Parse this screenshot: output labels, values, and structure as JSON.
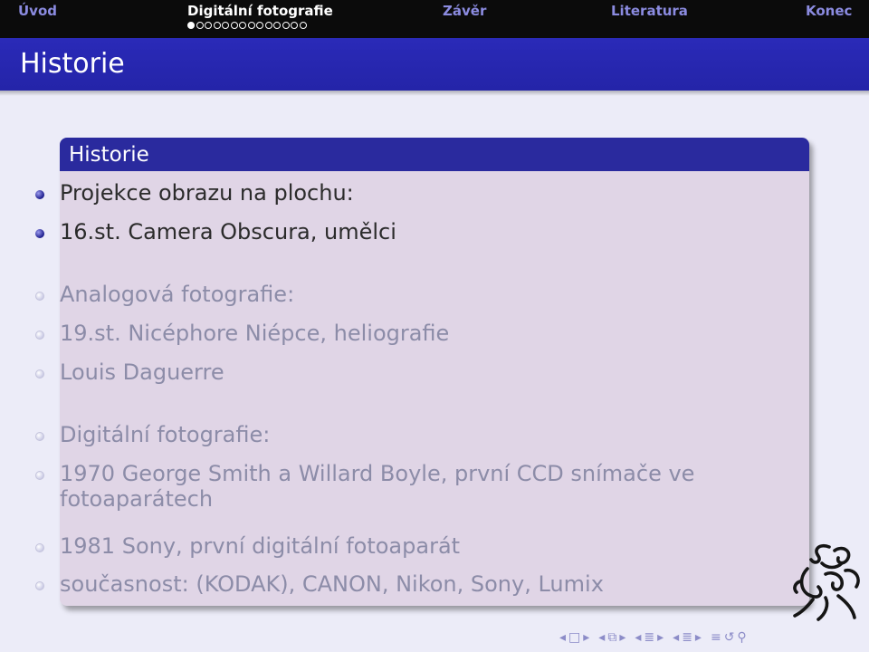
{
  "nav": {
    "items": [
      "Úvod",
      "Digitální fotografie",
      "Závěr",
      "Literatura",
      "Konec"
    ],
    "active_index": 1,
    "progress": {
      "current": 1,
      "total": 14
    }
  },
  "frame": {
    "title": "Historie"
  },
  "block": {
    "title": "Historie",
    "items": [
      {
        "text": "Projekce obrazu na plochu:",
        "visible": true
      },
      {
        "text": "16.st. Camera Obscura, umělci",
        "visible": true
      },
      {
        "text": "Analogová fotografie:",
        "visible": false
      },
      {
        "text": "19.st. Nicéphore Niépce, heliografie",
        "visible": false
      },
      {
        "text": "Louis Daguerre",
        "visible": false
      },
      {
        "text": "Digitální fotografie:",
        "visible": false
      },
      {
        "text": "1970 George Smith a Willard Boyle, první CCD snímače ve",
        "text2": "fotoaparátech",
        "visible": false
      },
      {
        "text": "1981 Sony, první digitální fotoaparát",
        "visible": false
      },
      {
        "text": "současnost: (KODAK), CANON, Nikon, Sony, Lumix",
        "visible": false
      }
    ]
  },
  "bottom_nav_icons": [
    "nav-left-icon",
    "nav-frame-icon",
    "nav-right-icon",
    "nav-left-icon",
    "nav-subsection-icon",
    "nav-right-icon",
    "nav-left-icon",
    "nav-section-icon",
    "nav-right-icon",
    "nav-left-icon",
    "nav-section-icon",
    "nav-right-icon",
    "nav-appendix-icon",
    "nav-search-icon",
    "nav-zoom-icon"
  ],
  "colors": {
    "nav_bg": "#0b0b0b",
    "nav_text": "#8b8be0",
    "titlebar": "#2424a8",
    "block_body": "#e0d5e6",
    "block_header": "#2a2a9e",
    "faded_text": "#8c8ca8"
  }
}
